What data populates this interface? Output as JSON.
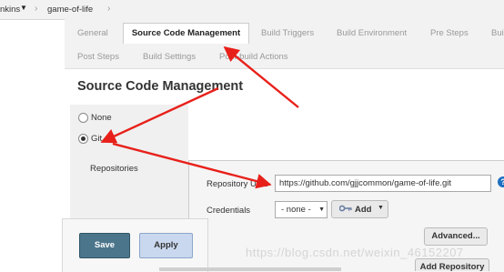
{
  "breadcrumb": {
    "root": "nkins",
    "job": "game-of-life",
    "separator": "›"
  },
  "tabs": {
    "row1": [
      "General",
      "Source Code Management",
      "Build Triggers",
      "Build Environment",
      "Pre Steps",
      "Bui"
    ],
    "row2": [
      "Post Steps",
      "Build Settings",
      "Post-build Actions"
    ]
  },
  "section": {
    "title": "Source Code Management"
  },
  "scm": {
    "options": [
      "None",
      "Git"
    ],
    "selected": "Git",
    "repositories_label": "Repositories"
  },
  "repo": {
    "url_label": "Repository URL",
    "url_value": "https://github.com/gjjcommon/game-of-life.git",
    "credentials_label": "Credentials",
    "credentials_value": "- none -",
    "add_label": "Add",
    "advanced_label": "Advanced...",
    "add_repository_label": "Add Repository"
  },
  "actions": {
    "save": "Save",
    "apply": "Apply"
  },
  "watermark": "https://blog.csdn.net/weixin_46152207",
  "icons": {
    "help": "?",
    "key": "key-icon",
    "dropdown": "▼"
  },
  "colors": {
    "arrow": "#e8201a",
    "save_button": "#4b758b",
    "apply_button": "#c9d8ef",
    "help_icon": "#1e6fbf"
  }
}
